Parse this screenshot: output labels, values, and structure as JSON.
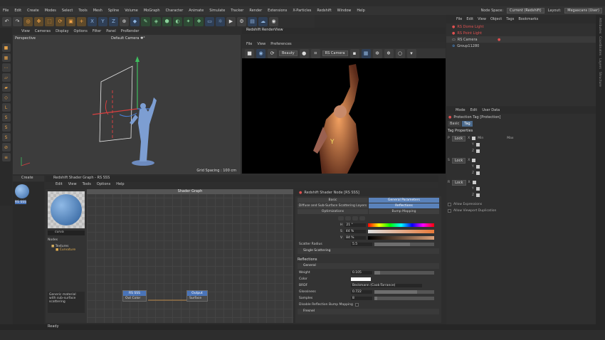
{
  "menu": [
    "File",
    "Edit",
    "Create",
    "Modes",
    "Select",
    "Tools",
    "Mesh",
    "Spline",
    "Volume",
    "MoGraph",
    "Character",
    "Animate",
    "Simulate",
    "Tracker",
    "Render",
    "Extensions",
    "X-Particles",
    "Redshift",
    "Window",
    "Help"
  ],
  "node_space_label": "Node Space:",
  "node_space_value": "Current (Redshift)",
  "layout_label": "Layout:",
  "layout_value": "Megascans (User)",
  "viewport": {
    "menu": [
      "View",
      "Cameras",
      "Display",
      "Options",
      "Filter",
      "Panel",
      "ProRender"
    ],
    "label_left": "Perspective",
    "label_camera": "Default Camera ✱°",
    "grid": "Grid Spacing : 100 cm"
  },
  "renderview": {
    "title": "Redshift RenderView",
    "menu": [
      "File",
      "View",
      "Preferences"
    ],
    "beauty": "Beauty",
    "camera": "RS Camera"
  },
  "objects": {
    "menu": [
      "File",
      "Edit",
      "View",
      "Object",
      "Tags",
      "Bookmarks"
    ],
    "rows": [
      {
        "name": "RS Dome Light",
        "color": "#e05050"
      },
      {
        "name": "RS Point Light",
        "color": "#e05050"
      },
      {
        "name": "RS Camera",
        "color": "#dddddd"
      },
      {
        "name": "Group11280",
        "color": "#dddddd"
      }
    ]
  },
  "attributes": {
    "menu": [
      "Mode",
      "Edit",
      "User Data"
    ],
    "title": "Protection Tag [Protection]",
    "tabs": [
      "Basic",
      "Tag"
    ],
    "section": "Tag Properties",
    "groups": [
      {
        "axis": "P",
        "mode": "Lock"
      },
      {
        "axis": "S",
        "mode": "Lock"
      },
      {
        "axis": "R",
        "mode": "Lock"
      }
    ],
    "labels": [
      "X",
      "Y",
      "Z"
    ],
    "min": "Min",
    "max": "Max",
    "options": [
      "Allow Expressions",
      "Allow Viewport Duplication"
    ]
  },
  "right_tabs": [
    "Attributes",
    "Coordinates",
    "Layers",
    "Structure"
  ],
  "material": {
    "create": "Create",
    "name": "RS SSS",
    "search": "curva",
    "nodes_label": "Nodes",
    "tree": [
      "Textures",
      "Curvature"
    ],
    "desc": "Generic material with sub-surface scattering"
  },
  "shader_graph": {
    "title": "Redshift Shader Graph - RS SSS",
    "menu": [
      "Edit",
      "View",
      "Tools",
      "Options",
      "Help"
    ],
    "header": "Shader Graph",
    "node_a": {
      "title": "RS SSS",
      "port": "Out Color"
    },
    "node_b": {
      "title": "Output",
      "port": "Surface"
    }
  },
  "shader_node": {
    "title": "Redshift Shader Node [RS SSS]",
    "tabs": [
      "Basic",
      "General Parameters",
      "Diffuse and Sub-Surface Scattering Layers",
      "Reflections",
      "Optimizations",
      "Bump Mapping"
    ],
    "hsv": [
      {
        "k": "H",
        "v": "21 °"
      },
      {
        "k": "S",
        "v": "44 %"
      },
      {
        "k": "V",
        "v": "84 %"
      }
    ],
    "scatter_label": "Scatter Radius",
    "scatter_value": "5.5",
    "single": "Single Scattering",
    "refl": "Reflections",
    "general": "General",
    "params": [
      {
        "n": "Weight",
        "v": "0.105",
        "fill": 0.1
      },
      {
        "n": "Color",
        "v": "",
        "fill": 0
      },
      {
        "n": "BRDF",
        "v": "Beckmann (Cook-Torrance)",
        "fill": 0
      },
      {
        "n": "Glossiness",
        "v": "0.722",
        "fill": 0.72
      },
      {
        "n": "Samples",
        "v": "8",
        "fill": 0.05
      }
    ],
    "bump": "Disable Reflection Bump Mapping",
    "fresnel": "Fresnel"
  },
  "status": "Ready"
}
